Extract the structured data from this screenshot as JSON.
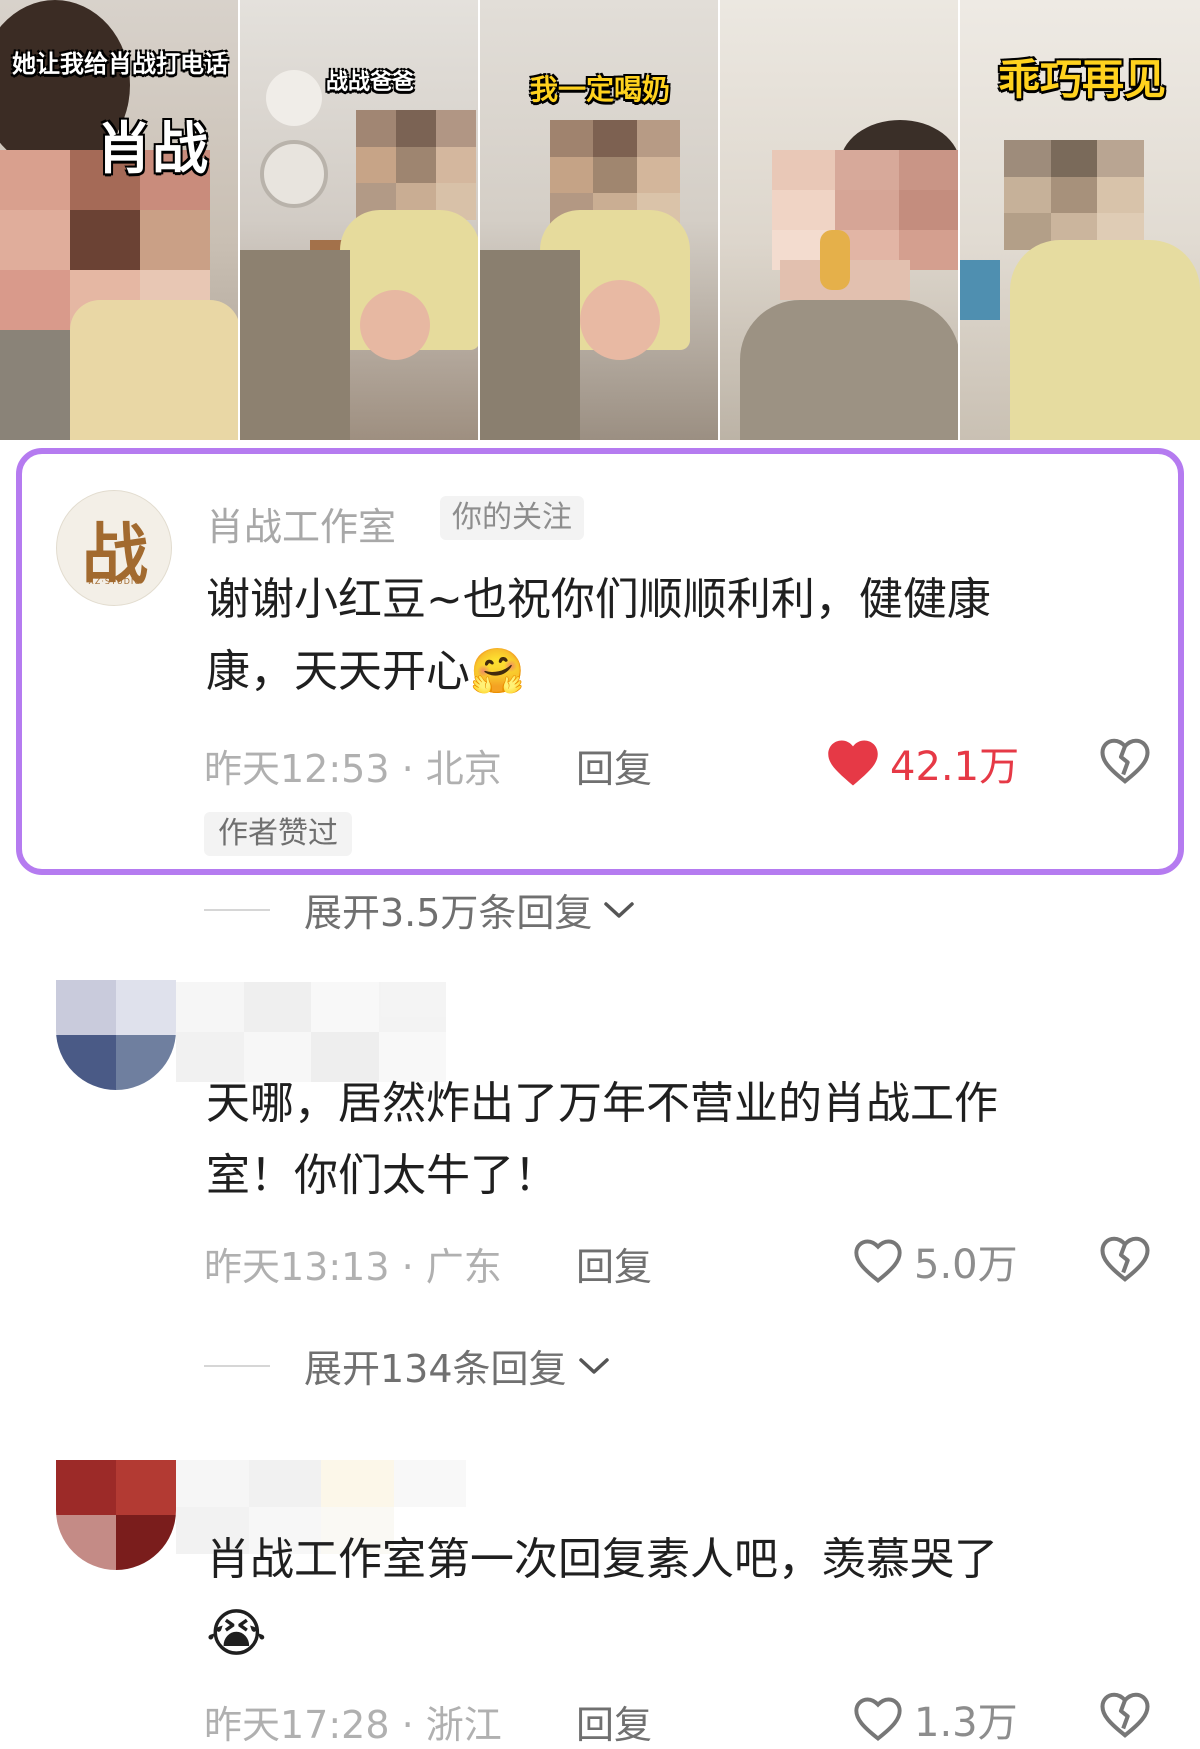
{
  "video_strip": {
    "captions": [
      "她让我给肖战打电话",
      "肖战",
      "战战爸爸",
      "我一定喝奶",
      "乖巧再见"
    ]
  },
  "comments": [
    {
      "author": "肖战工作室",
      "follow_badge": "你的关注",
      "avatar_glyph": "战",
      "avatar_sub": "XZ·STUDIO",
      "text_lines": [
        "谢谢小红豆~也祝你们顺顺利利，健健康",
        "康，天天开心"
      ],
      "emoji": "🤗",
      "time": "昨天12:53",
      "location": "北京",
      "reply_label": "回复",
      "likes": "42.1万",
      "liked": true,
      "author_liked_tag": "作者赞过",
      "expand_label": "展开3.5万条回复"
    },
    {
      "text_lines": [
        "天哪，居然炸出了万年不营业的肖战工作",
        "室！你们太牛了！"
      ],
      "time": "昨天13:13",
      "location": "广东",
      "reply_label": "回复",
      "likes": "5.0万",
      "liked": false,
      "expand_label": "展开134条回复"
    },
    {
      "text_lines": [
        "肖战工作室第一次回复素人吧，羡慕哭了"
      ],
      "emoji": "😭",
      "time": "昨天17:28",
      "location": "浙江",
      "reply_label": "回复",
      "likes": "1.3万",
      "liked": false
    }
  ],
  "meta_separator": "·",
  "colors": {
    "highlight_border": "#b57bf0",
    "like_active": "#e63946"
  }
}
